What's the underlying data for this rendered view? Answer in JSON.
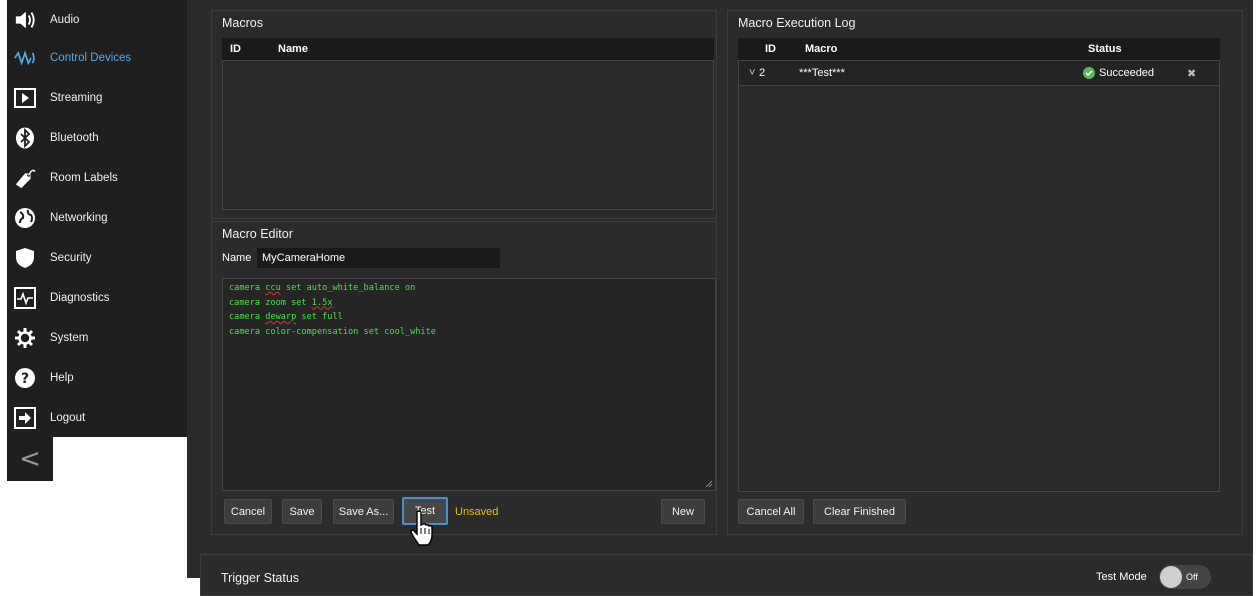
{
  "sidebar": {
    "items": [
      {
        "label": "Audio",
        "icon": "speaker-icon",
        "active": false
      },
      {
        "label": "Control Devices",
        "icon": "signal-waves-icon",
        "active": true
      },
      {
        "label": "Streaming",
        "icon": "play-box-icon",
        "active": false
      },
      {
        "label": "Bluetooth",
        "icon": "bluetooth-icon",
        "active": false
      },
      {
        "label": "Room Labels",
        "icon": "tag-icon",
        "active": false
      },
      {
        "label": "Networking",
        "icon": "globe-icon",
        "active": false
      },
      {
        "label": "Security",
        "icon": "shield-icon",
        "active": false
      },
      {
        "label": "Diagnostics",
        "icon": "pulse-icon",
        "active": false
      },
      {
        "label": "System",
        "icon": "gear-icon",
        "active": false
      },
      {
        "label": "Help",
        "icon": "question-icon",
        "active": false
      },
      {
        "label": "Logout",
        "icon": "logout-icon",
        "active": false
      }
    ],
    "collapse_glyph": "<"
  },
  "macros": {
    "title": "Macros",
    "columns": {
      "id": "ID",
      "name": "Name"
    }
  },
  "editor": {
    "title": "Macro Editor",
    "name_label": "Name",
    "name_value": "MyCameraHome",
    "lines": [
      [
        "camera ",
        "ccu",
        " set auto_white_balance on"
      ],
      [
        "camera zoom set ",
        "1.5x",
        ""
      ],
      [
        "camera ",
        "dewarp",
        " set full"
      ],
      [
        "camera color-compensation set cool_white",
        "",
        ""
      ]
    ],
    "buttons": {
      "cancel": "Cancel",
      "save": "Save",
      "save_as": "Save As...",
      "test": "Test",
      "new": "New"
    },
    "status": "Unsaved"
  },
  "log": {
    "title": "Macro Execution Log",
    "columns": {
      "id": "ID",
      "macro": "Macro",
      "status": "Status"
    },
    "rows": [
      {
        "expander": "˅",
        "id": "2",
        "macro": "***Test***",
        "status": "Succeeded",
        "remove": "✖"
      }
    ],
    "buttons": {
      "cancel_all": "Cancel All",
      "clear_finished": "Clear Finished"
    }
  },
  "trigger": {
    "title": "Trigger Status",
    "test_mode_label": "Test Mode",
    "toggle_value": "Off"
  },
  "colors": {
    "accent": "#55a9e8",
    "code": "#4be04b",
    "unsaved": "#e6c100",
    "success": "#5cb85c"
  }
}
